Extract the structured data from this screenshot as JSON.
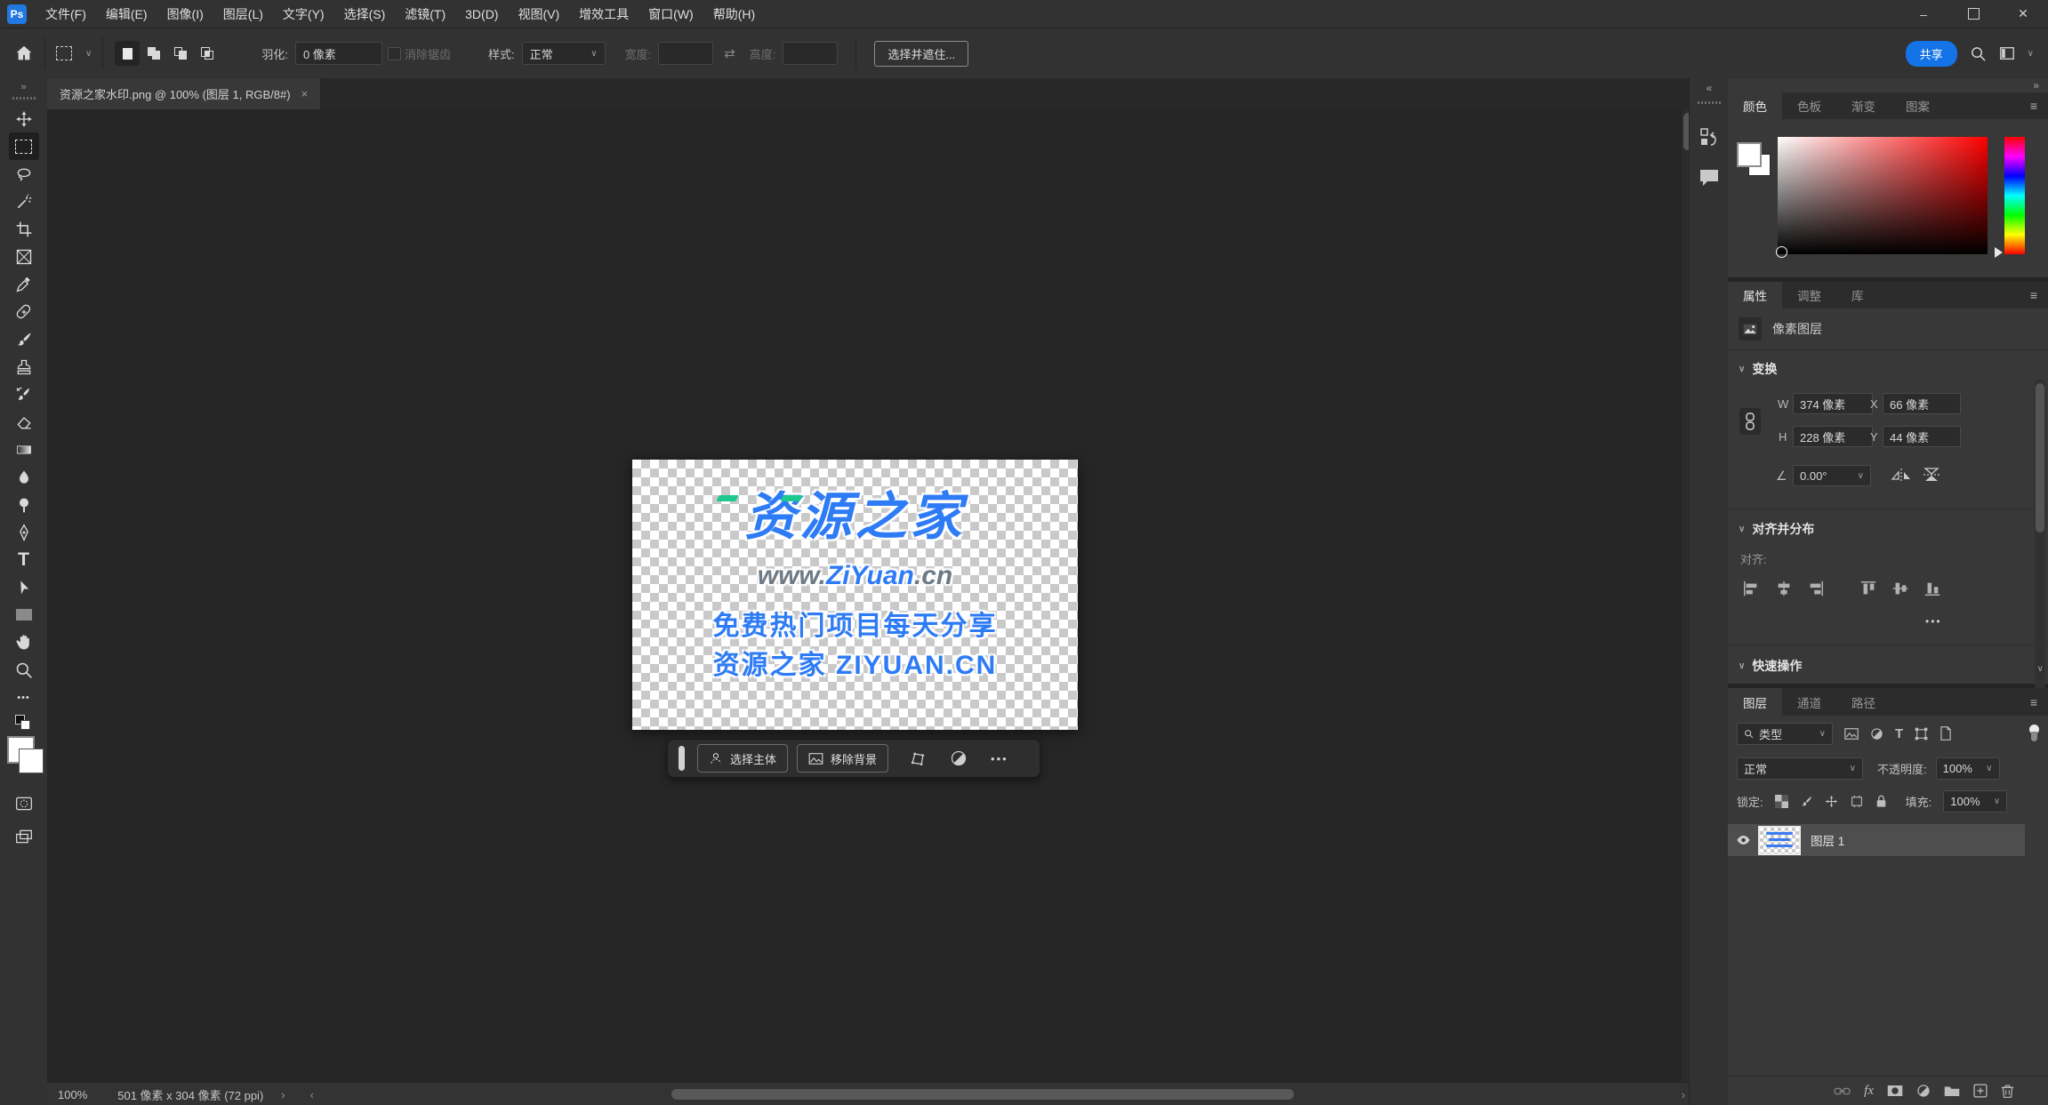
{
  "app": {
    "logo_text": "Ps"
  },
  "menu_bar": {
    "items": [
      "文件(F)",
      "编辑(E)",
      "图像(I)",
      "图层(L)",
      "文字(Y)",
      "选择(S)",
      "滤镜(T)",
      "3D(D)",
      "视图(V)",
      "增效工具",
      "窗口(W)",
      "帮助(H)"
    ]
  },
  "window_controls": {
    "minimize": "–",
    "close": "✕"
  },
  "options_bar": {
    "feather_label": "羽化:",
    "feather_value": "0 像素",
    "anti_alias_label": "消除锯齿",
    "style_label": "样式:",
    "style_value": "正常",
    "width_label": "宽度:",
    "height_label": "高度:",
    "select_and_mask": "选择并遮住...",
    "share": "共享"
  },
  "document_tab": {
    "title": "资源之家水印.png @ 100% (图层 1, RGB/8#)",
    "close": "×"
  },
  "canvas": {
    "watermark": {
      "brand": "资源之家",
      "url_prefix": "www.",
      "url_mid": "ZiYuan",
      "url_suffix": ".cn",
      "line1": "免费热门项目每天分享",
      "line2": "资源之家 ZIYUAN.CN",
      "blue": "#2e7bf6",
      "green": "#1ec98f",
      "gray": "#6e7a84"
    },
    "context_bar": {
      "select_subject": "选择主体",
      "remove_background": "移除背景"
    }
  },
  "status_bar": {
    "zoom": "100%",
    "doc_info": "501 像素 x 304 像素 (72 ppi)"
  },
  "panels": {
    "color": {
      "tab_color": "颜色",
      "tab_swatches": "色板",
      "tab_gradients": "渐变",
      "tab_patterns": "图案"
    },
    "properties": {
      "tab_properties": "属性",
      "tab_adjustments": "调整",
      "tab_libraries": "库",
      "layer_type": "像素图层",
      "transform_header": "变换",
      "w_label": "W",
      "w_value": "374 像素",
      "x_label": "X",
      "x_value": "66 像素",
      "h_label": "H",
      "h_value": "228 像素",
      "y_label": "Y",
      "y_value": "44 像素",
      "angle_value": "0.00°",
      "align_header": "对齐并分布",
      "align_label": "对齐:",
      "quick_actions_header": "快速操作"
    },
    "layers": {
      "tab_layers": "图层",
      "tab_channels": "通道",
      "tab_paths": "路径",
      "filter_label": "类型",
      "blend_mode": "正常",
      "opacity_label": "不透明度:",
      "opacity_value": "100%",
      "lock_label": "锁定:",
      "fill_label": "填充:",
      "fill_value": "100%",
      "layer_name": "图层 1"
    }
  },
  "glyphs": {
    "collapse_left": "«",
    "collapse_right": "»",
    "toolbar_expand": "»",
    "chevron": "∨",
    "hamburger": "≡",
    "ellipsis": "•••",
    "swap": "⇄",
    "angle": "∠",
    "status_next": "›",
    "scroll_left": "‹",
    "scroll_right": "›",
    "fx": "fx",
    "type_tool": "T",
    "type_filter": "T"
  },
  "colors": {
    "accent": "#1473e6"
  }
}
